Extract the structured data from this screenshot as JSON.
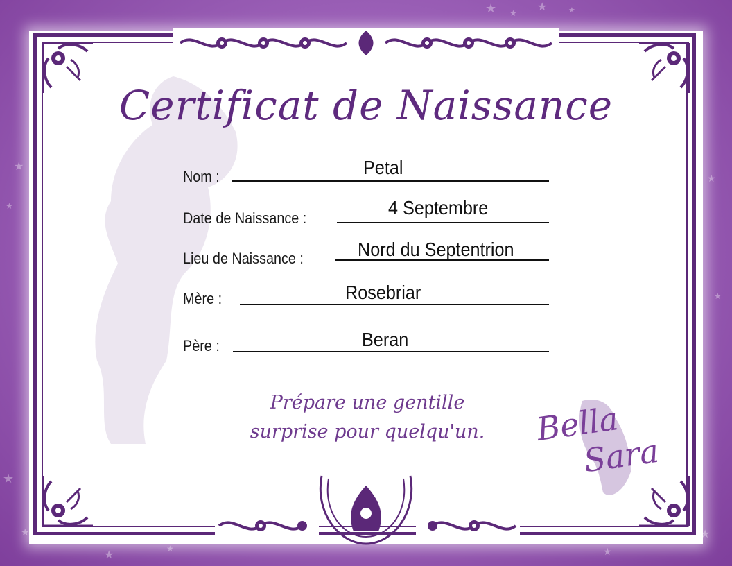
{
  "certificate": {
    "title": "Certificat de Naissance",
    "fields": [
      {
        "label": "Nom :",
        "value": "Petal"
      },
      {
        "label": "Date de Naissance :",
        "value": "4 Septembre"
      },
      {
        "label": "Lieu de Naissance :",
        "value": "Nord du Septentrion"
      },
      {
        "label": "Mère :",
        "value": "Rosebriar"
      },
      {
        "label": "Père :",
        "value": "Beran"
      }
    ],
    "motto": [
      "Prépare une gentille",
      "surprise pour quelqu'un."
    ]
  },
  "brand": {
    "line1": "Bella",
    "line2": "Sara"
  },
  "colors": {
    "purple_frame": "#5b2878",
    "purple_bg": "#8a4fa6",
    "title_purple": "#5e2a7e"
  },
  "icons": [
    "star-icon",
    "horse-silhouette-icon",
    "corner-ornament-icon",
    "swirl-ornament-icon",
    "horseshoe-ornament-icon"
  ]
}
